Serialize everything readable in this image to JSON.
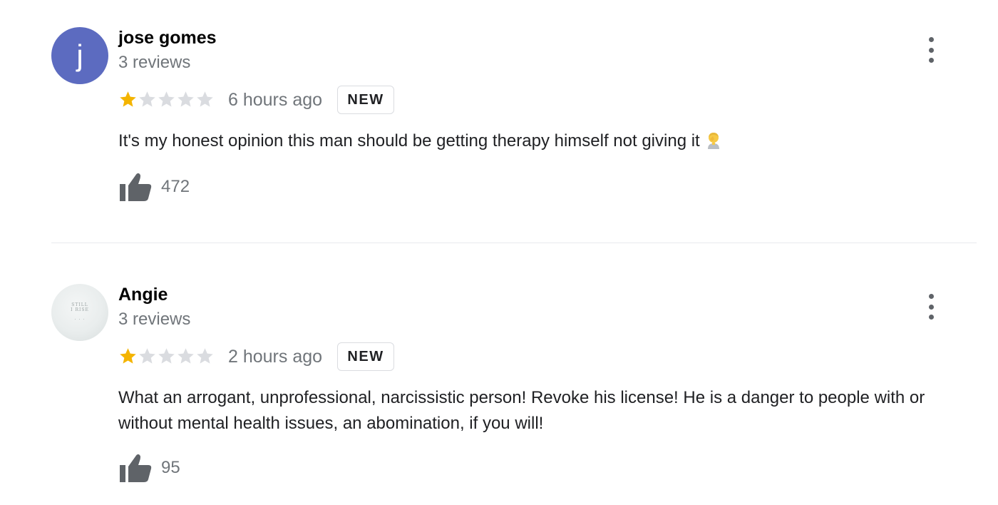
{
  "reviews": [
    {
      "avatar_letter": "j",
      "avatar_color": "#5c6bc0",
      "name": "jose gomes",
      "review_count": "3 reviews",
      "rating": 1,
      "max_rating": 5,
      "time_ago": "6 hours ago",
      "badge": "NEW",
      "text": "It's my honest opinion this man should be getting therapy himself not giving it",
      "emoji_icon": "facepalm-emoji-icon",
      "likes": "472"
    },
    {
      "avatar_letter": "",
      "avatar_image_text": "STILL I RISE",
      "name": "Angie",
      "review_count": "3 reviews",
      "rating": 1,
      "max_rating": 5,
      "time_ago": "2 hours ago",
      "badge": "NEW",
      "text": "What an arrogant, unprofessional, narcissistic person! Revoke his license! He is a danger to people with or without mental health issues, an abomination, if you will!",
      "likes": "95"
    }
  ],
  "colors": {
    "star_filled": "#f4b400",
    "star_empty": "#dadce0",
    "secondary_text": "#70757a",
    "icon_gray": "#5f6368"
  }
}
